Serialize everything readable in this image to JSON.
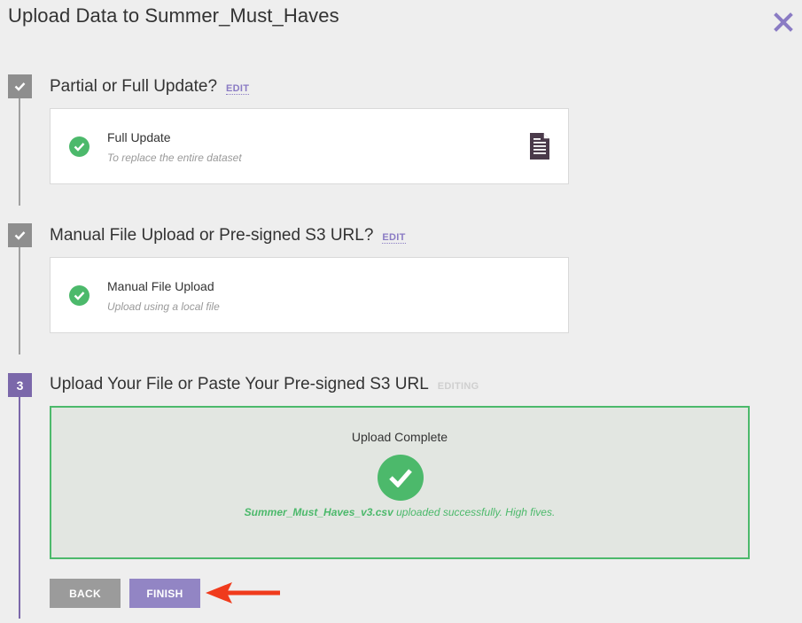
{
  "dialog": {
    "title": "Upload Data to Summer_Must_Haves",
    "close_icon": "close-icon"
  },
  "steps": [
    {
      "marker": "check-icon",
      "heading": "Partial or Full Update?",
      "action": "EDIT",
      "selection": {
        "title": "Full Update",
        "description": "To replace the entire dataset",
        "icon": "document-icon"
      }
    },
    {
      "marker": "check-icon",
      "heading": "Manual File Upload or Pre-signed S3 URL?",
      "action": "EDIT",
      "selection": {
        "title": "Manual File Upload",
        "description": "Upload using a local file"
      }
    },
    {
      "marker": "3",
      "heading": "Upload Your File or Paste Your Pre-signed S3 URL",
      "action": "EDITING",
      "upload": {
        "status": "Upload Complete",
        "filename": "Summer_Must_Haves_v3.csv",
        "message": " uploaded successfully. High fives."
      }
    }
  ],
  "buttons": {
    "back": "BACK",
    "finish": "FINISH"
  },
  "colors": {
    "accent": "#7b68aa",
    "success": "#4cb96b",
    "arrow": "#f03b1c",
    "background": "#eeeeee"
  }
}
